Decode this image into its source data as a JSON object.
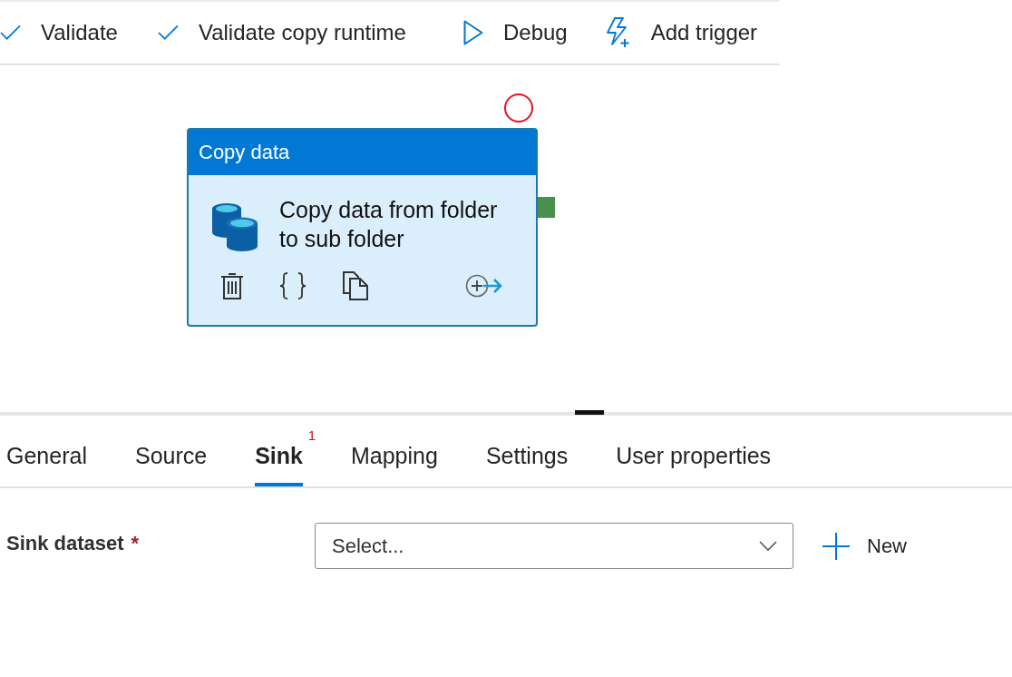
{
  "toolbar": {
    "items": [
      {
        "kind": "check",
        "label": "Validate"
      },
      {
        "kind": "check",
        "label": "Validate copy runtime"
      },
      {
        "kind": "play",
        "label": "Debug"
      },
      {
        "kind": "trigger",
        "label": "Add trigger"
      }
    ]
  },
  "canvas": {
    "activity": {
      "type_label": "Copy data",
      "name": "Copy data from folder to sub folder",
      "error_marker": true
    }
  },
  "panel": {
    "tabs": [
      {
        "label": "General",
        "selected": false
      },
      {
        "label": "Source",
        "selected": false
      },
      {
        "label": "Sink",
        "selected": true,
        "badge": "1"
      },
      {
        "label": "Mapping",
        "selected": false
      },
      {
        "label": "Settings",
        "selected": false
      },
      {
        "label": "User properties",
        "selected": false
      }
    ],
    "fields": [
      {
        "label": "Sink dataset",
        "required_mark": "*",
        "placeholder": "Select...",
        "action": "New"
      }
    ]
  }
}
